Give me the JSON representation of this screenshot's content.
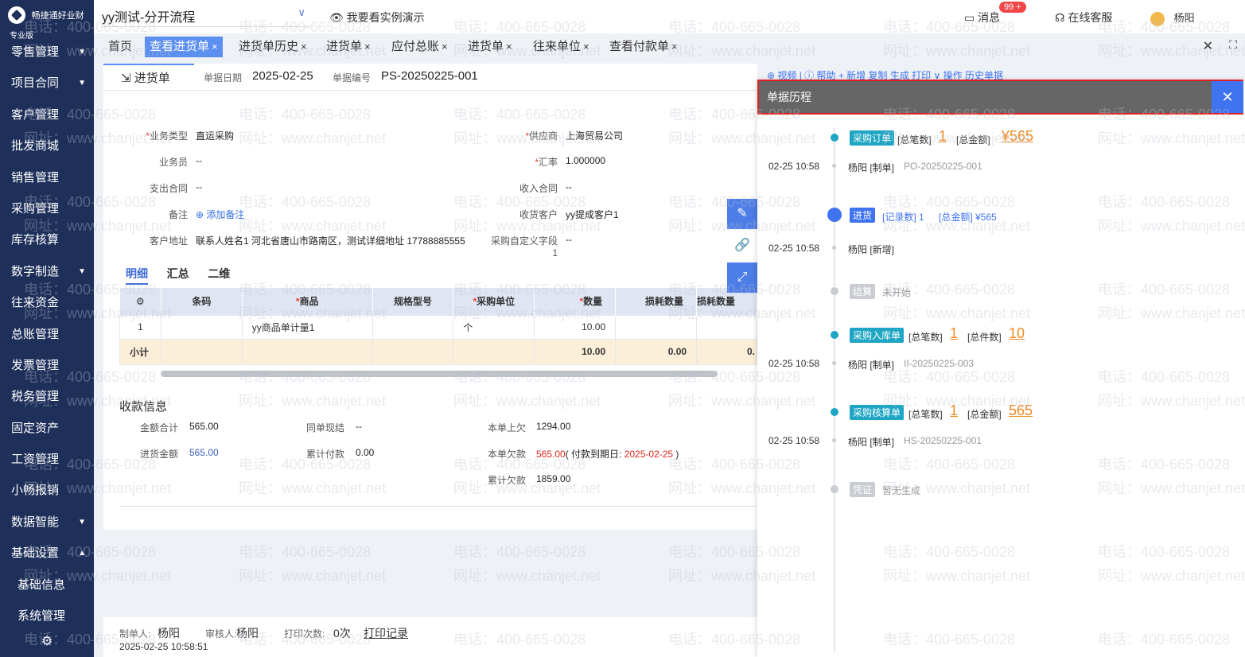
{
  "app": {
    "logo_text": "畅捷通好业财",
    "edition": "专业版"
  },
  "sidebar": {
    "items": [
      {
        "label": "零售管理",
        "arrow": "▼"
      },
      {
        "label": "项目合同",
        "arrow": "▼"
      },
      {
        "label": "客户管理",
        "arrow": ""
      },
      {
        "label": "批发商城",
        "arrow": ""
      },
      {
        "label": "销售管理",
        "arrow": ""
      },
      {
        "label": "采购管理",
        "arrow": ""
      },
      {
        "label": "库存核算",
        "arrow": ""
      },
      {
        "label": "数字制造",
        "arrow": "▼"
      },
      {
        "label": "往来资金",
        "arrow": ""
      },
      {
        "label": "总账管理",
        "arrow": ""
      },
      {
        "label": "发票管理",
        "arrow": ""
      },
      {
        "label": "税务管理",
        "arrow": ""
      },
      {
        "label": "固定资产",
        "arrow": ""
      },
      {
        "label": "工资管理",
        "arrow": ""
      },
      {
        "label": "小畅报销",
        "arrow": ""
      },
      {
        "label": "数据智能",
        "arrow": "▼"
      },
      {
        "label": "基础设置",
        "arrow": "▲"
      },
      {
        "label": "基础信息",
        "arrow": ""
      },
      {
        "label": "系统管理",
        "arrow": ""
      }
    ]
  },
  "topbar": {
    "account": "yy测试-分开流程",
    "demo": "我要看实例演示",
    "messages": "消息",
    "badge": "99 +",
    "service": "在线客服",
    "user": "杨阳"
  },
  "tabs": [
    {
      "label": "首页",
      "close": ""
    },
    {
      "label": "查看进货单",
      "close": "×"
    },
    {
      "label": "进货单历史",
      "close": "×"
    },
    {
      "label": "进货单",
      "close": "×"
    },
    {
      "label": "应付总账",
      "close": "×"
    },
    {
      "label": "进货单",
      "close": "×"
    },
    {
      "label": "往来单位",
      "close": "×"
    },
    {
      "label": "查看付款单",
      "close": "×"
    }
  ],
  "doc": {
    "tab": "进货单",
    "date_label": "单据日期",
    "date": "2025-02-25",
    "no_label": "单据编号",
    "no": "PS-20250225-001"
  },
  "form": {
    "biz_type_label": "业务类型",
    "biz_type": "直运采购",
    "supplier_label": "供应商",
    "supplier": "上海贸易公司",
    "clerk_label": "业务员",
    "clerk": "--",
    "rate_label": "汇率",
    "rate": "1.000000",
    "pay_contract_label": "支出合同",
    "pay_contract": "--",
    "recv_contract_label": "收入合同",
    "recv_contract": "--",
    "note_label": "备注",
    "note_add": "添加备注",
    "recv_customer_label": "收货客户",
    "recv_customer": "yy提成客户1",
    "addr_label": "客户地址",
    "addr": "联系人姓名1 河北省唐山市路南区，测试详细地址 17788885555",
    "custom_label": "采购自定义字段1",
    "custom": "--"
  },
  "detail_tabs": [
    "明细",
    "汇总",
    "二维"
  ],
  "grid": {
    "headers": [
      "条码",
      "商品",
      "规格型号",
      "采购单位",
      "数量",
      "损耗数量",
      "损耗数量"
    ],
    "row": [
      "1",
      "",
      "yy商品单计量1",
      "",
      "个",
      "10.00",
      ""
    ],
    "subtotal_label": "小计",
    "subtotal_qty": "10.00",
    "subtotal_loss": "0.00",
    "subtotal_loss2": "0."
  },
  "payment": {
    "title": "收款信息",
    "total_label": "金额合计",
    "total": "565.00",
    "cash_label": "同单现结",
    "cash": "--",
    "prev_label": "本单上欠",
    "prev": "1294.00",
    "purchase_label": "进货金额",
    "purchase": "565.00",
    "paid_label": "累计付款",
    "paid": "0.00",
    "owe_label": "本单欠款",
    "owe": "565.00",
    "due_prefix": "( 付款到期日: ",
    "due": "2025-02-25",
    "due_suffix": " )",
    "cum_owe_label": "累计欠款",
    "cum_owe": "1859.00"
  },
  "footer": {
    "maker_label": "制单人:",
    "maker": "杨阳",
    "auditor_label": "审核人:",
    "auditor": "杨阳",
    "print_label": "打印次数:",
    "print_count": "0次",
    "print_record": "打印记录",
    "time": "2025-02-25 10:58:51"
  },
  "toolbar_partial": "⊕ 视频 | ⓘ 帮助   + 新增   复制   生成   打印 ∨   操作   历史单据",
  "history": {
    "title": "单据历程",
    "close": "✕",
    "entries": [
      {
        "tag": "采购订单",
        "l1": "[总笔数]",
        "v1": "1",
        "l2": "[总金额]",
        "v2": "¥565",
        "time": "02-25 10:58",
        "who": "杨阳 [制单]",
        "ref": "PO-20250225-001"
      },
      {
        "tag": "进货",
        "l1": "[记录数] 1",
        "l2": "[总金额] ¥565",
        "time": "02-25 10:58",
        "who": "杨阳 [新增]"
      },
      {
        "tag": "结算",
        "status": "未开始"
      },
      {
        "tag": "采购入库单",
        "l1": "[总笔数]",
        "v1": "1",
        "l2": "[总件数]",
        "v2": "10",
        "time": "02-25 10:58",
        "who": "杨阳 [制单]",
        "ref": "II-20250225-003"
      },
      {
        "tag": "采购核算单",
        "l1": "[总笔数]",
        "v1": "1",
        "l2": "[总金额]",
        "v2": "565",
        "time": "02-25 10:58",
        "who": "杨阳 [制单]",
        "ref": "HS-20250225-001"
      },
      {
        "tag": "凭证",
        "status": "暂无生成"
      }
    ]
  },
  "watermark": {
    "phone": "电话：400-665-0028",
    "site": "网址：www.chanjet.net"
  },
  "colors": {
    "sidebar": "#1e2f5a",
    "accent": "#5b8ff0",
    "panel_close": "#3f73f0",
    "highlight": "#e02020",
    "orange": "#f08a24"
  }
}
